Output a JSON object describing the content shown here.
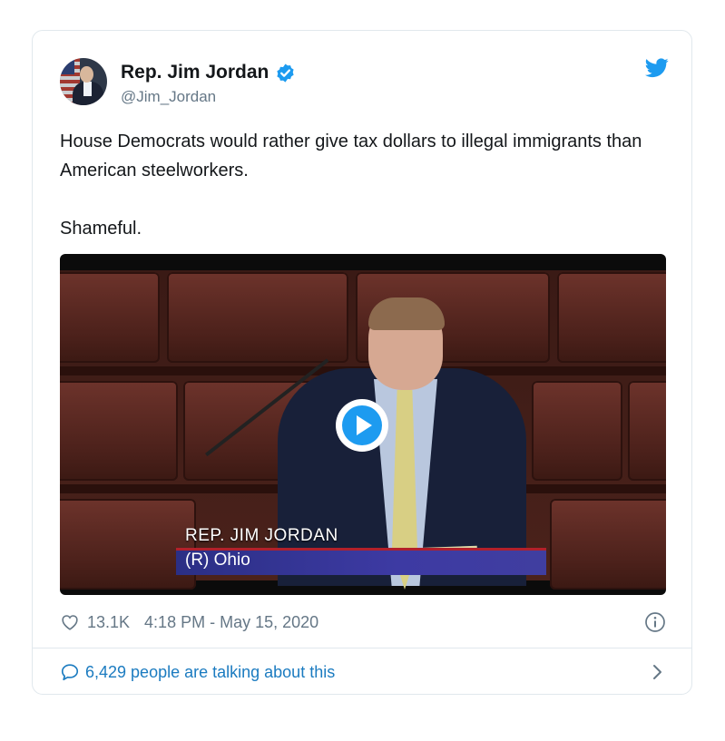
{
  "tweet": {
    "author_name": "Rep. Jim Jordan",
    "handle": "@Jim_Jordan",
    "verified": true,
    "text_line1": "House Democrats would rather give tax dollars to illegal immigrants than American steelworkers.",
    "text_line2": "Shameful.",
    "video": {
      "lower_third_name": "REP. JIM JORDAN",
      "lower_third_sub": "(R) Ohio"
    },
    "likes": "13.1K",
    "timestamp": "4:18 PM - May 15, 2020",
    "conversation_text": "6,429 people are talking about this"
  },
  "icons": {
    "verified": "verified-badge-icon",
    "brand": "twitter-bird-icon",
    "like": "heart-outline-icon",
    "info": "info-circle-icon",
    "reply": "speech-bubble-icon",
    "more": "chevron-right-icon",
    "play": "play-icon"
  },
  "colors": {
    "brand_blue": "#1d9bf0",
    "link_blue": "#1b7bc0",
    "secondary_text": "#657786",
    "border": "#e1e8ed"
  }
}
